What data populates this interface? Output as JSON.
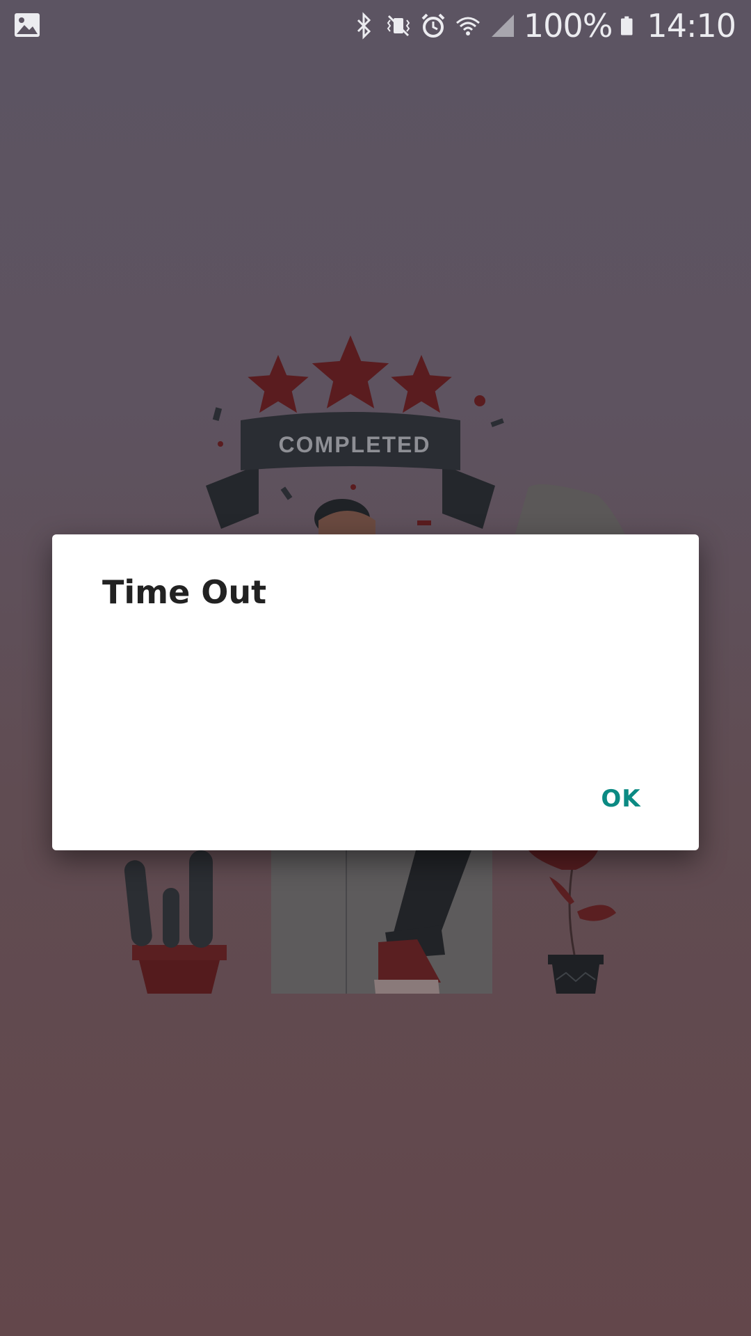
{
  "status_bar": {
    "battery_text": "100%",
    "time": "14:10",
    "icons": [
      "gallery-icon",
      "bluetooth-icon",
      "vibrate-icon",
      "alarm-icon",
      "wifi-icon",
      "signal-icon",
      "battery-icon"
    ]
  },
  "illustration": {
    "banner_text": "COMPLETED",
    "star_count": 3
  },
  "dialog": {
    "title": "Time Out",
    "ok_label": "OK"
  },
  "colors": {
    "accent": "#0b8a83",
    "star": "#5a1c1f",
    "banner": "#2a2d33"
  }
}
